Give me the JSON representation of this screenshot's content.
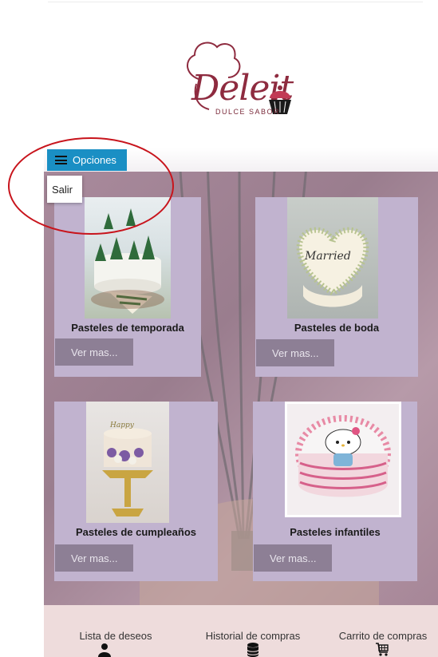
{
  "logo": {
    "brand": "Deleit",
    "tagline": "DULCE SABOR"
  },
  "menu": {
    "label": "Opciones",
    "dropdown_items": [
      "Salir"
    ]
  },
  "products": [
    {
      "title": "Pasteles de temporada",
      "button": "Ver mas..."
    },
    {
      "title": "Pasteles de boda",
      "button": "Ver mas..."
    },
    {
      "title": "Pasteles de cumpleaños",
      "button": "Ver mas..."
    },
    {
      "title": "Pasteles infantiles",
      "button": "Ver mas..."
    }
  ],
  "footer": {
    "wishlist": "Lista de deseos",
    "history": "Historial de compras",
    "cart": "Carrito de compras"
  },
  "colors": {
    "menu_button": "#1a8fc4",
    "card": "#c1b3cf",
    "card_button": "#8d7f95",
    "footer": "#eedcdc",
    "brand": "#8e2b3f",
    "annotation": "#c8141c"
  },
  "icons": [
    "hamburger-icon",
    "user-icon",
    "database-icon",
    "cart-icon",
    "cupcake-icon",
    "chef-hat-icon"
  ]
}
